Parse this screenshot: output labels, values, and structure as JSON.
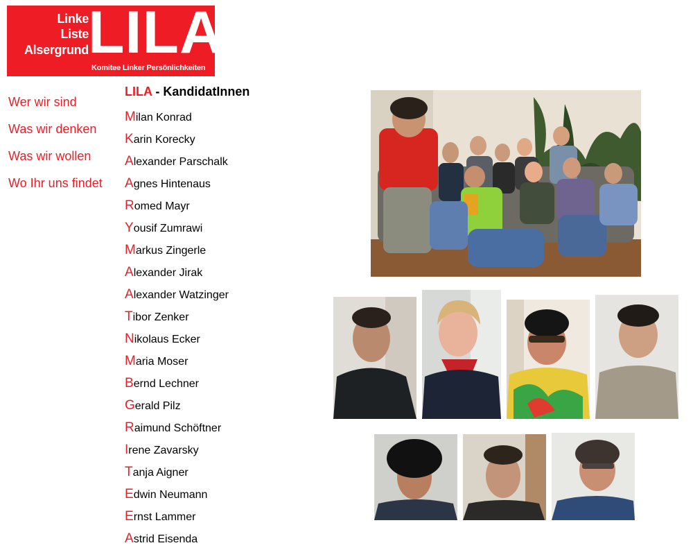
{
  "logo": {
    "line1": "Linke",
    "line2": "Liste",
    "line3": "Alsergrund",
    "big": "LILA",
    "subtitle": "Komitee Linker Persönlichkeiten"
  },
  "nav": {
    "items": [
      {
        "label": "Wer wir sind"
      },
      {
        "label": "Was wir denken"
      },
      {
        "label": "Was wir wollen"
      },
      {
        "label": "Wo Ihr uns findet"
      }
    ]
  },
  "heading": {
    "red": "LILA",
    "rest": " - KandidatInnen"
  },
  "candidates": [
    {
      "initial": "M",
      "rest": "ilan Konrad"
    },
    {
      "initial": "K",
      "rest": "arin Korecky"
    },
    {
      "initial": "A",
      "rest": "lexander Parschalk"
    },
    {
      "initial": "A",
      "rest": "gnes Hintenaus"
    },
    {
      "initial": "R",
      "rest": "omed Mayr"
    },
    {
      "initial": "Y",
      "rest": "ousif Zumrawi"
    },
    {
      "initial": "M",
      "rest": "arkus Zingerle"
    },
    {
      "initial": "A",
      "rest": "lexander Jirak"
    },
    {
      "initial": "A",
      "rest": "lexander Watzinger"
    },
    {
      "initial": "T",
      "rest": "ibor Zenker"
    },
    {
      "initial": "N",
      "rest": "ikolaus Ecker"
    },
    {
      "initial": "M",
      "rest": "aria Moser"
    },
    {
      "initial": "B",
      "rest": "ernd Lechner"
    },
    {
      "initial": "G",
      "rest": "erald Pilz"
    },
    {
      "initial": "R",
      "rest": "aimund Schöftner"
    },
    {
      "initial": "I",
      "rest": "rene Zavarsky"
    },
    {
      "initial": "T",
      "rest": "anja Aigner"
    },
    {
      "initial": "E",
      "rest": "dwin Neumann"
    },
    {
      "initial": "E",
      "rest": "rnst Lammer"
    },
    {
      "initial": "A",
      "rest": "strid Eisenda"
    }
  ],
  "colors": {
    "brand_red": "#ee1c25"
  }
}
